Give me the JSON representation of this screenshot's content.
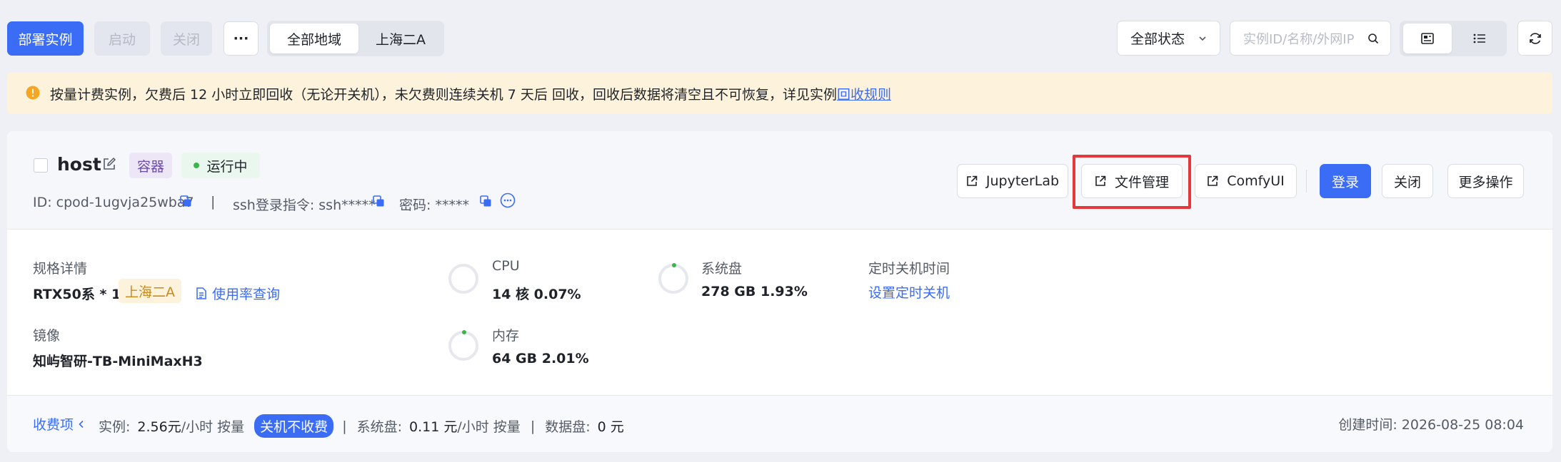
{
  "toolbar": {
    "deploy": "部署实例",
    "start": "启动",
    "close": "关闭",
    "more": "···",
    "regions": [
      "全部地域",
      "上海二A"
    ],
    "status_select": "全部状态",
    "search_placeholder": "实例ID/名称/外网IP"
  },
  "notice": {
    "text": "按量计费实例，欠费后 12 小时立即回收（无论开关机），未欠费则连续关机 7 天后 回收，回收后数据将清空且不可恢复，详见实例",
    "link": "回收规则"
  },
  "instance": {
    "name": "host",
    "type_tag": "容器",
    "status": "运行中",
    "id_text": "ID: cpod-1ugvja25wba7",
    "divider": "|",
    "ssh_text": "ssh登录指令: ssh*****",
    "password_text": "密码: *****",
    "actions": {
      "jupyter": "JupyterLab",
      "files": "文件管理",
      "comfy": "ComfyUI",
      "login": "登录",
      "close": "关闭",
      "more": "更多操作"
    }
  },
  "specs": {
    "spec_label": "规格详情",
    "spec_value": "RTX50系 * 1",
    "region_tag": "上海二A",
    "usage_link": "使用率查询",
    "image_label": "镜像",
    "image_value": "知屿智研-TB-MiniMaxH3",
    "cpu_label": "CPU",
    "cpu_value": "14 核 0.07%",
    "mem_label": "内存",
    "mem_value": "64 GB 2.01%",
    "disk_label": "系统盘",
    "disk_value": "278 GB 1.93%",
    "timer_label": "定时关机时间",
    "timer_link": "设置定时关机"
  },
  "billing": {
    "toggle": "收费项",
    "instance_label": "实例:",
    "instance_price": "2.56元",
    "instance_unit": "/小时 按量",
    "off_badge": "关机不收费",
    "sep": "|",
    "disk_label": "系统盘:",
    "disk_price": "0.11 元",
    "disk_unit": "/小时 按量",
    "data_label": "数据盘:",
    "data_price": "0 元",
    "created": "创建时间: 2026-08-25 08:04"
  },
  "colors": {
    "primary": "#3b6cf6",
    "status_green": "#3bb54a",
    "highlight_red": "#e5383b",
    "notice_bg": "#fdf3dc",
    "warn_orange": "#f5a623"
  }
}
